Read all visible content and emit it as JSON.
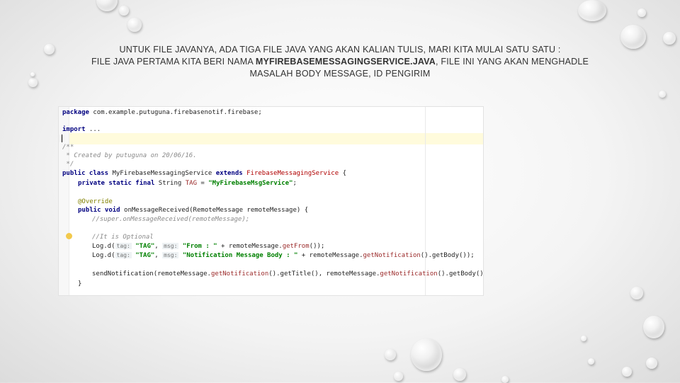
{
  "slide": {
    "heading_line1": "UNTUK FILE JAVANYA, ADA TIGA FILE JAVA YANG AKAN KALIAN TULIS, MARI KITA MULAI SATU SATU :",
    "heading_line2_pre": "FILE JAVA PERTAMA KITA BERI NAMA ",
    "heading_line2_bold": "MYFIREBASEMESSAGINGSERVICE.JAVA",
    "heading_line2_post": ", FILE INI YANG AKAN MENGHADLE",
    "heading_line3": "MASALAH BODY MESSAGE, ID PENGIRIM"
  },
  "code": {
    "l1_kw": "package",
    "l1_rest": " com.example.putuguna.firebasenotif.firebase;",
    "l2_kw": "import",
    "l2_rest": " ...",
    "l3": "/**",
    "l4": " * Created by putuguna on 20/06/16.",
    "l5": " */",
    "l6_kw1": "public class",
    "l6_name": " MyFirebaseMessagingService ",
    "l6_kw2": "extends",
    "l6_type": " FirebaseMessagingService",
    "l6_end": " {",
    "l7_kw": "private static final",
    "l7_mid": " String ",
    "l7_field": "TAG",
    "l7_eq": " = ",
    "l7_str": "\"MyFirebaseMsgService\"",
    "l7_end": ";",
    "l8": "@Override",
    "l9_kw": "public void",
    "l9_rest": " onMessageReceived(RemoteMessage remoteMessage) {",
    "l10": "//super.onMessageReceived(remoteMessage);",
    "l11": "//It is Optional",
    "l12_a": "Log.d(",
    "l12_hint1": "tag:",
    "l12_s1": " \"TAG\"",
    "l12_b": ", ",
    "l12_hint2": "msg:",
    "l12_s2": " \"From : \"",
    "l12_c": " + remoteMessage.",
    "l12_fn": "getFrom",
    "l12_d": "());",
    "l13_a": "Log.d(",
    "l13_hint1": "tag:",
    "l13_s1": " \"TAG\"",
    "l13_b": ", ",
    "l13_hint2": "msg:",
    "l13_s2": " \"Notification Message Body : \"",
    "l13_c": " + remoteMessage.",
    "l13_fn": "getNotification",
    "l13_d": "().getBody());",
    "l14_a": "sendNotification(remoteMessage.",
    "l14_fn1": "getNotification",
    "l14_b": "().getTitle(), remoteMessage.",
    "l14_fn2": "getNotification",
    "l14_c": "().getBody());",
    "l15": "}"
  }
}
